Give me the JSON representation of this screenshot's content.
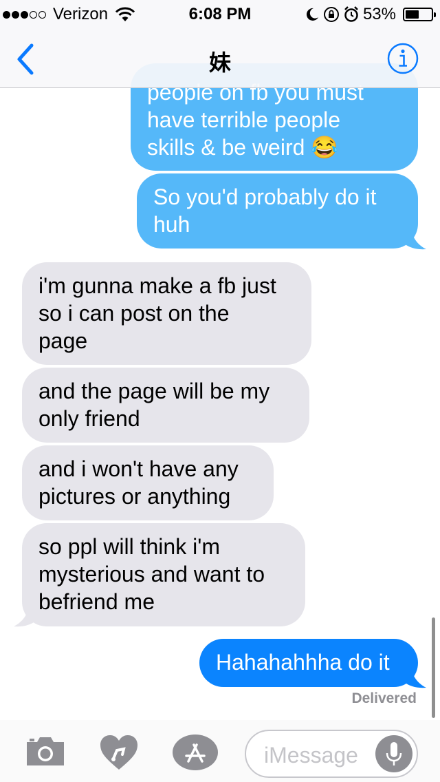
{
  "status_bar": {
    "carrier": "Verizon",
    "signal_dots_filled": 3,
    "signal_dots_total": 5,
    "time": "6:08 PM",
    "battery": "53%",
    "battery_level": 0.53
  },
  "nav": {
    "title": "妹",
    "back_icon": "chevron-left-icon",
    "info_icon": "info-icon"
  },
  "messages": [
    {
      "direction": "sent",
      "text": "people on fb you must\nhave terrible people\nskills & be weird 😂"
    },
    {
      "direction": "sent",
      "text": "So you'd probably do it\nhuh"
    },
    {
      "direction": "received",
      "text": "i'm gunna make a fb just\nso i can post on the\npage"
    },
    {
      "direction": "received",
      "text": "and the page will be my\nonly friend"
    },
    {
      "direction": "received",
      "text": "and i won't have any\npictures or anything"
    },
    {
      "direction": "received",
      "text": "so ppl will think i'm\nmysterious and want to\nbefriend me"
    },
    {
      "direction": "sent",
      "text": "Hahahahhha do it"
    }
  ],
  "delivered_label": "Delivered",
  "input_bar": {
    "placeholder": "iMessage",
    "icons": [
      "camera-icon",
      "digital-touch-heart-icon",
      "app-store-icon",
      "microphone-icon"
    ]
  },
  "colors": {
    "sent_bubble": "#55b8f9",
    "sent_bubble_latest": "#0b84fe",
    "received_bubble": "#e6e5eb",
    "accent": "#0a7aff"
  }
}
